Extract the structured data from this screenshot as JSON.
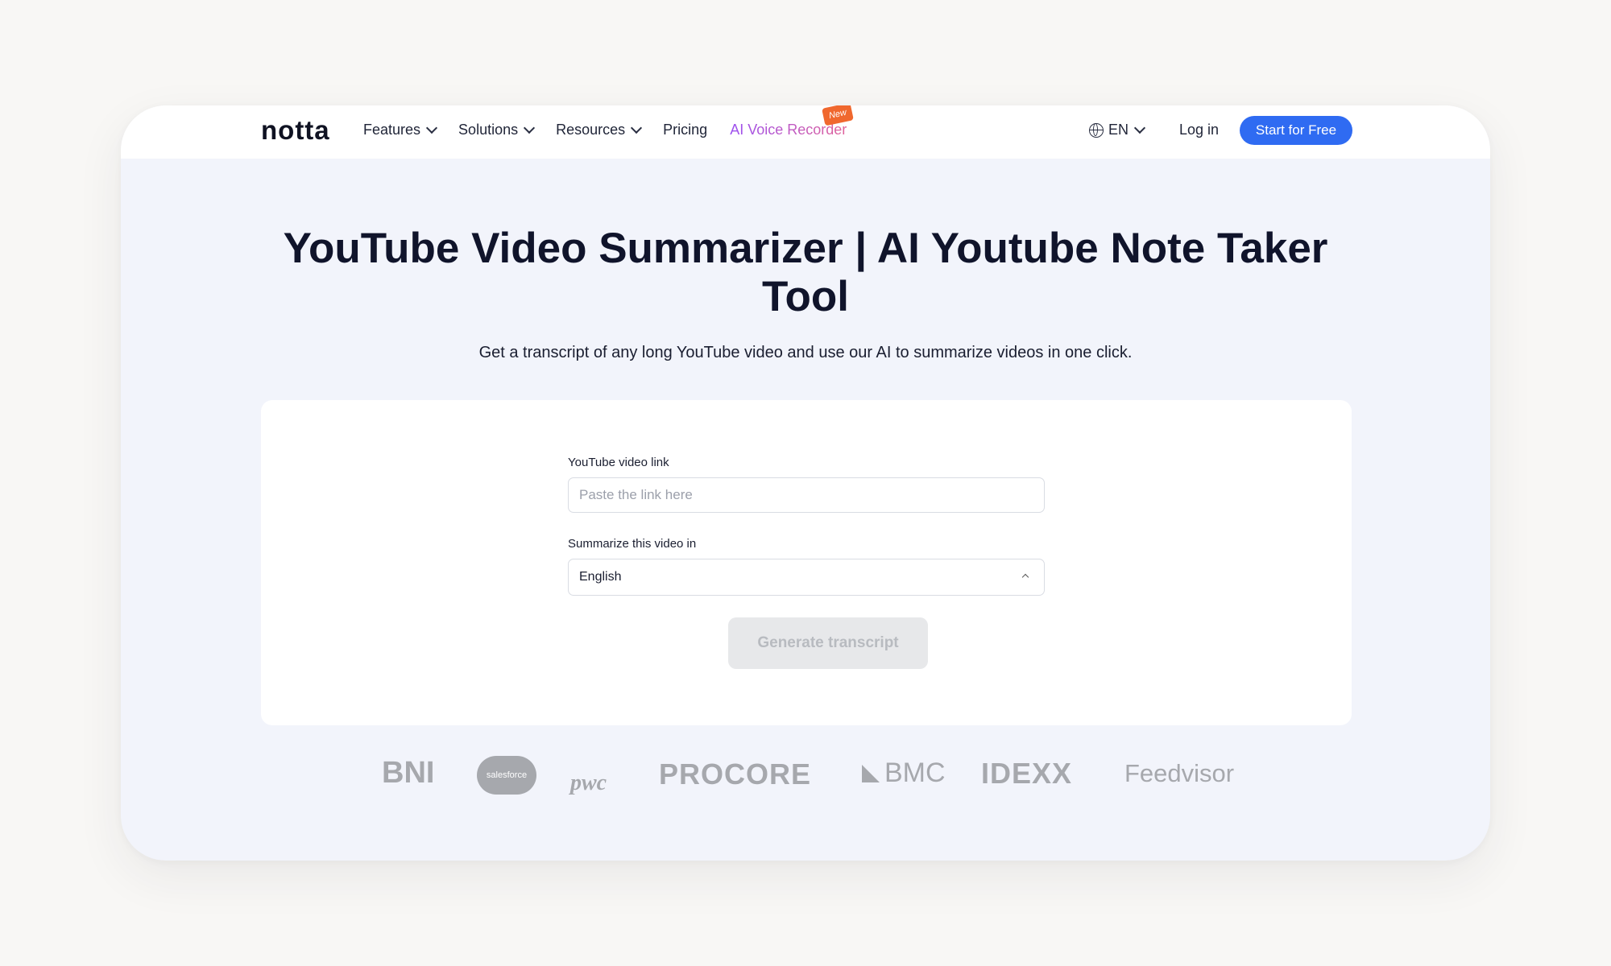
{
  "nav": {
    "logo": "notta",
    "features": "Features",
    "solutions": "Solutions",
    "resources": "Resources",
    "pricing": "Pricing",
    "voice_recorder": "AI Voice Recorder",
    "new_badge": "New",
    "language": "EN",
    "login": "Log in",
    "start": "Start for Free"
  },
  "hero": {
    "title": "YouTube Video Summarizer | AI Youtube Note Taker Tool",
    "subtitle": "Get a transcript of any long YouTube video and use our AI to summarize videos in one click."
  },
  "form": {
    "link_label": "YouTube video link",
    "link_placeholder": "Paste the link here",
    "link_value": "",
    "lang_label": "Summarize this video in",
    "lang_value": "English",
    "button": "Generate transcript"
  },
  "logos": {
    "bni": "BNI",
    "salesforce": "salesforce",
    "pwc": "pwc",
    "procore": "PROCORE",
    "bmc": "BMC",
    "idexx": "IDEXX",
    "feedvisor": "Feedvisor"
  },
  "colors": {
    "accent": "#2f6bf2",
    "badge": "#f0682e",
    "background": "#f2f4fb"
  }
}
